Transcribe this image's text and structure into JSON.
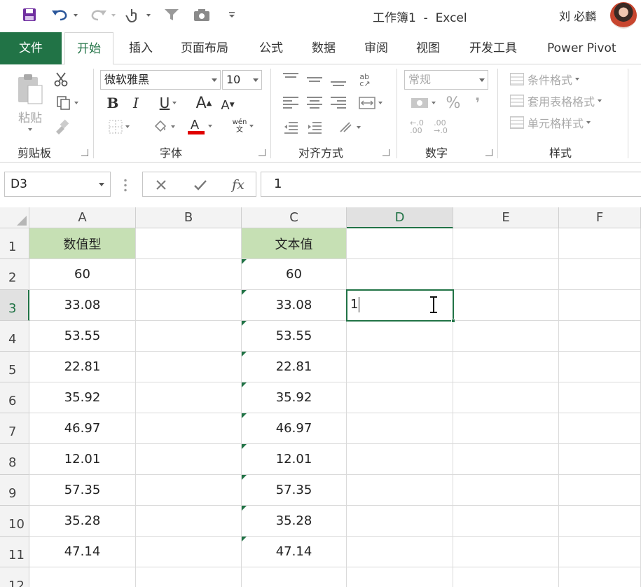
{
  "window": {
    "title": "工作簿1  -  Excel",
    "user": "刘 必麟"
  },
  "tabs": [
    "文件",
    "开始",
    "插入",
    "页面布局",
    "公式",
    "数据",
    "审阅",
    "视图",
    "开发工具",
    "Power Pivot"
  ],
  "ribbon": {
    "clipboard": {
      "paste_label": "粘贴",
      "group_label": "剪贴板"
    },
    "font": {
      "font_name": "微软雅黑",
      "font_size": "10",
      "group_label": "字体",
      "phonetic_label": "wén\n文"
    },
    "alignment": {
      "group_label": "对齐方式"
    },
    "number": {
      "format": "常规",
      "percent_symbol": "%",
      "comma_symbol": "❜",
      "group_label": "数字"
    },
    "styles": {
      "conditional_label": "条件格式",
      "table_label": "套用表格格式",
      "cell_styles_label": "单元格样式",
      "group_label": "样式"
    }
  },
  "formula_bar": {
    "name_box": "D3",
    "fx": "fx",
    "value": "1"
  },
  "sheet": {
    "columns": [
      "A",
      "B",
      "C",
      "D",
      "E",
      "F"
    ],
    "selected_column": "D",
    "rows": [
      "1",
      "2",
      "3",
      "4",
      "5",
      "6",
      "7",
      "8",
      "9",
      "10",
      "11",
      "12"
    ],
    "selected_row": "3",
    "header_a": "数值型",
    "header_c": "文本值",
    "values_a": [
      "60",
      "33.08",
      "53.55",
      "22.81",
      "35.92",
      "46.97",
      "12.01",
      "57.35",
      "35.28",
      "47.14"
    ],
    "values_c": [
      "60",
      "33.08",
      "53.55",
      "22.81",
      "35.92",
      "46.97",
      "12.01",
      "57.35",
      "35.28",
      "47.14"
    ],
    "active_cell_value": "1"
  },
  "colors": {
    "accent": "#217346",
    "header_fill": "#c6e0b4",
    "font_color_bar": "#e00000"
  }
}
